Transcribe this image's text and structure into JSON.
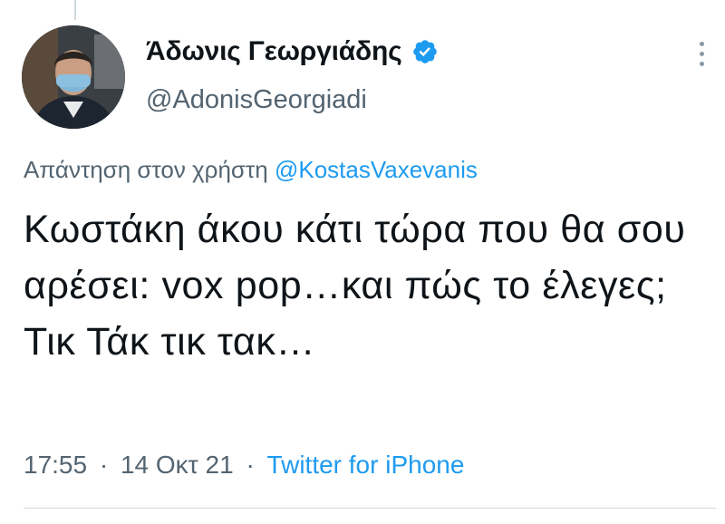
{
  "tweet": {
    "author": {
      "display_name": "Άδωνις Γεωργιάδης",
      "handle": "@AdonisGeorgiadi",
      "verified_icon": "verified-badge-icon",
      "avatar_icon": "avatar"
    },
    "reply": {
      "prefix": "Απάντηση στον χρήστη",
      "mention": "@KostasVaxevanis"
    },
    "text": "Κωστάκη άκου κάτι τώρα που θα σου αρέσει: vox pop…και πώς το έλεγες; Τικ Τάκ τικ τακ…",
    "time": "17:55",
    "date": "14 Οκτ 21",
    "source": "Twitter for iPhone",
    "separator": "·",
    "more_icon": "more-options-icon"
  },
  "colors": {
    "accent": "#1d9bf0",
    "text": "#0f1419",
    "secondary": "#536471",
    "border": "#cfd9de"
  }
}
